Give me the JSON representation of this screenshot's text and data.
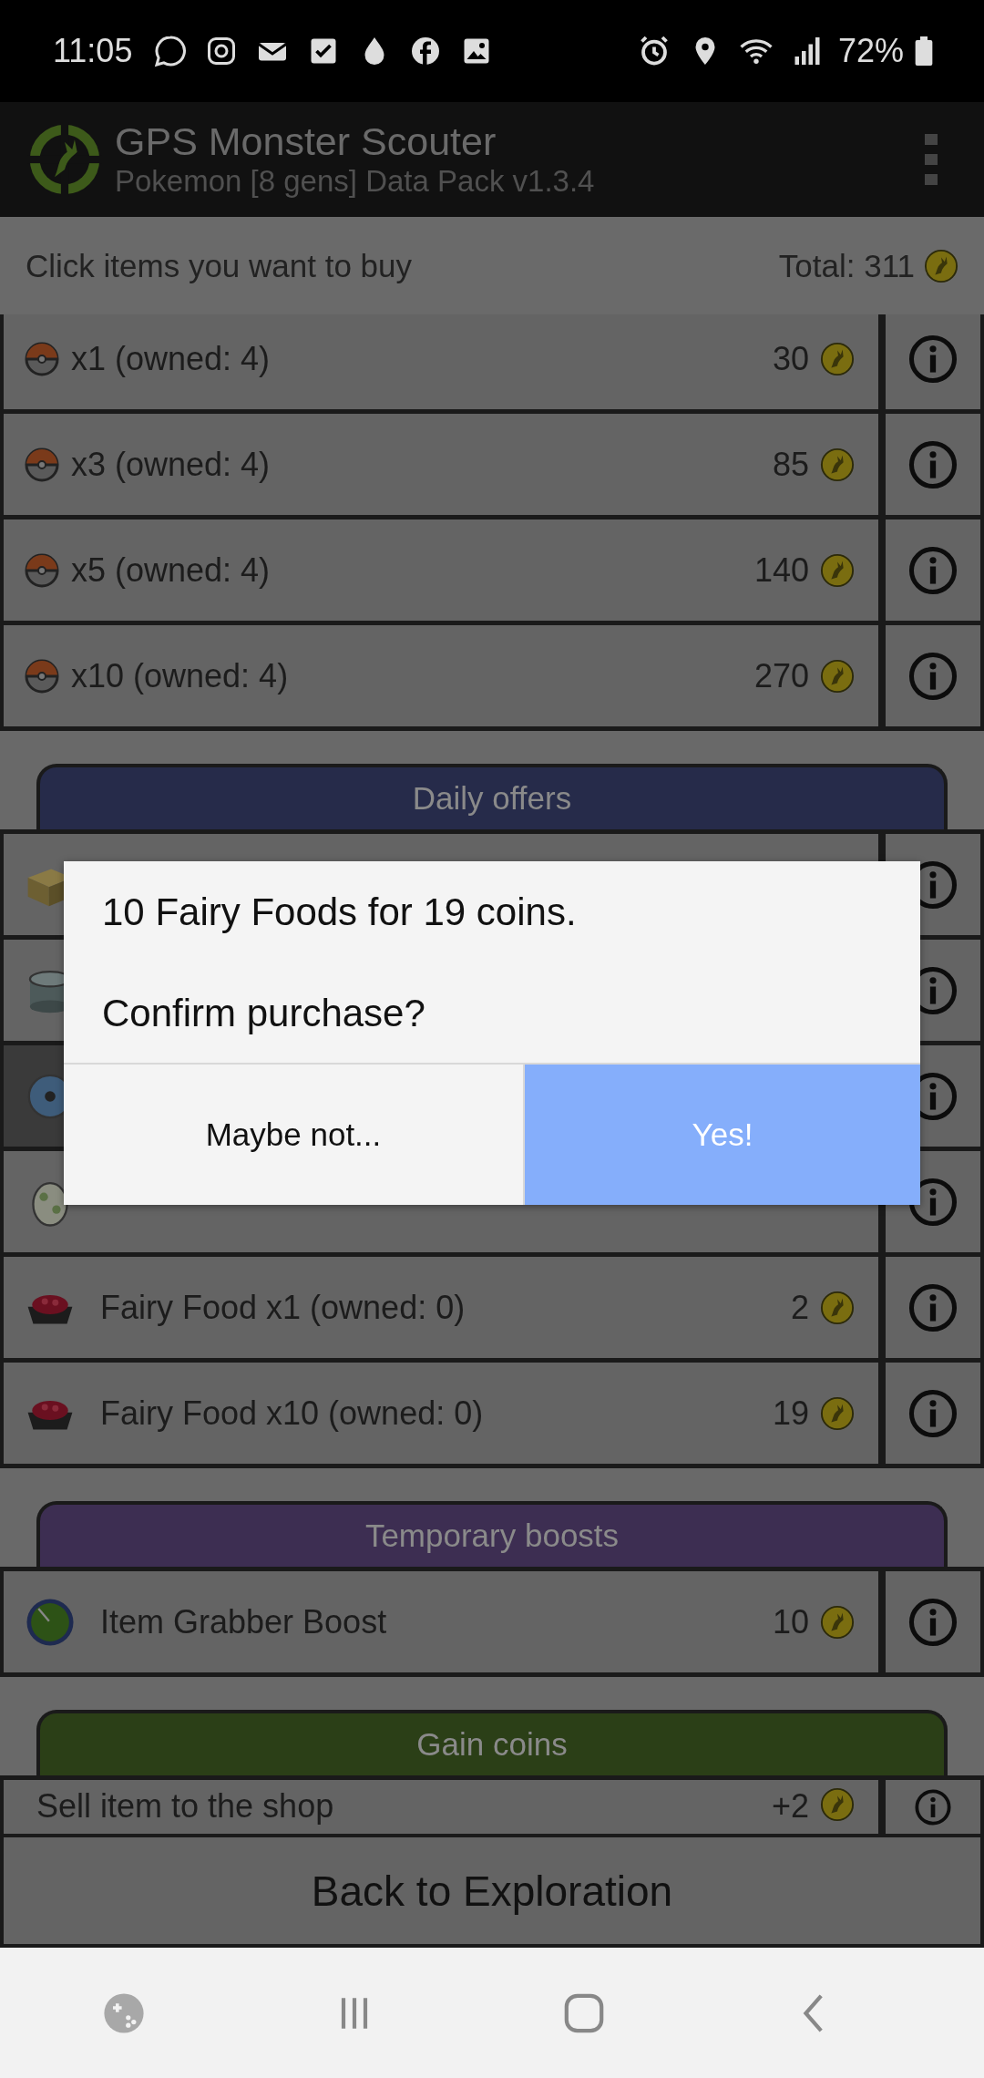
{
  "status_bar": {
    "time": "11:05",
    "battery": "72%"
  },
  "app_bar": {
    "title": "GPS Monster Scouter",
    "subtitle": "Pokemon [8 gens] Data Pack v1.3.4"
  },
  "header": {
    "instruction": "Click items you want to buy",
    "total": "Total: 311"
  },
  "sections": [
    {
      "items": [
        {
          "kind": "ball",
          "name": "x1 (owned: 4)",
          "price": "30",
          "selected": false
        },
        {
          "kind": "ball",
          "name": "x3 (owned: 4)",
          "price": "85",
          "selected": false
        },
        {
          "kind": "ball",
          "name": "x5 (owned: 4)",
          "price": "140",
          "selected": false
        },
        {
          "kind": "ball",
          "name": "x10 (owned: 4)",
          "price": "270",
          "selected": false
        }
      ]
    },
    {
      "title": "Daily offers",
      "color": "#262b4a",
      "items": [
        {
          "kind": "crate",
          "selected": false
        },
        {
          "kind": "tin",
          "selected": false
        },
        {
          "kind": "disc",
          "selected": true
        },
        {
          "kind": "egg",
          "selected": false
        },
        {
          "kind": "fairy_food",
          "name": "Fairy Food x1 (owned: 0)",
          "price": "2",
          "selected": false
        },
        {
          "kind": "fairy_food",
          "name": "Fairy Food x10 (owned: 0)",
          "price": "19",
          "selected": false
        }
      ]
    },
    {
      "title": "Temporary boosts",
      "color": "#3d2e52",
      "items": [
        {
          "kind": "grabber",
          "name": "Item Grabber Boost",
          "price": "10",
          "selected": false
        }
      ]
    },
    {
      "title": "Gain coins",
      "color": "#2b3f17",
      "items": [
        {
          "kind": "none",
          "name": "Sell item to the shop",
          "price": "+2",
          "selected": false
        }
      ]
    }
  ],
  "back_button": "Back to Exploration",
  "dialog": {
    "message": "10 Fairy Foods for 19 coins.",
    "question": "Confirm purchase?",
    "buttons": [
      {
        "label": "Maybe not...",
        "kind": "secondary"
      },
      {
        "label": "Yes!",
        "kind": "primary"
      }
    ]
  }
}
